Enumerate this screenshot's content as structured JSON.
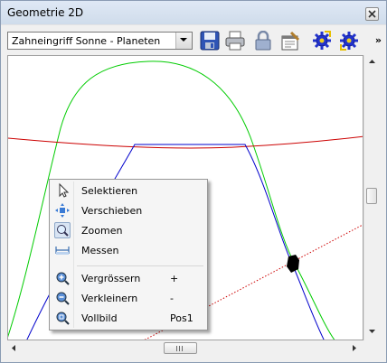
{
  "window": {
    "title": "Geometrie 2D"
  },
  "toolbar": {
    "combo_value": "Zahneingriff Sonne - Planeten",
    "buttons": [
      "save-icon",
      "print-icon",
      "lock-icon",
      "properties-icon",
      "gear-icon",
      "gear-icon"
    ],
    "overflow": "»"
  },
  "context_menu": {
    "items": [
      {
        "label": "Selektieren",
        "icon": "cursor-icon",
        "shortcut": ""
      },
      {
        "label": "Verschieben",
        "icon": "move-icon",
        "shortcut": ""
      },
      {
        "label": "Zoomen",
        "icon": "zoom-icon",
        "shortcut": "",
        "active": true
      },
      {
        "label": "Messen",
        "icon": "measure-icon",
        "shortcut": ""
      },
      {
        "label": "Vergrössern",
        "icon": "zoom-in-icon",
        "shortcut": "+"
      },
      {
        "label": "Verkleinern",
        "icon": "zoom-out-icon",
        "shortcut": "-"
      },
      {
        "label": "Vollbild",
        "icon": "zoom-fit-icon",
        "shortcut": "Pos1"
      }
    ]
  },
  "colors": {
    "green_curve": "#00cc00",
    "red_curve": "#cc0000",
    "blue_profile": "#0000cc",
    "marker": "#000000"
  }
}
